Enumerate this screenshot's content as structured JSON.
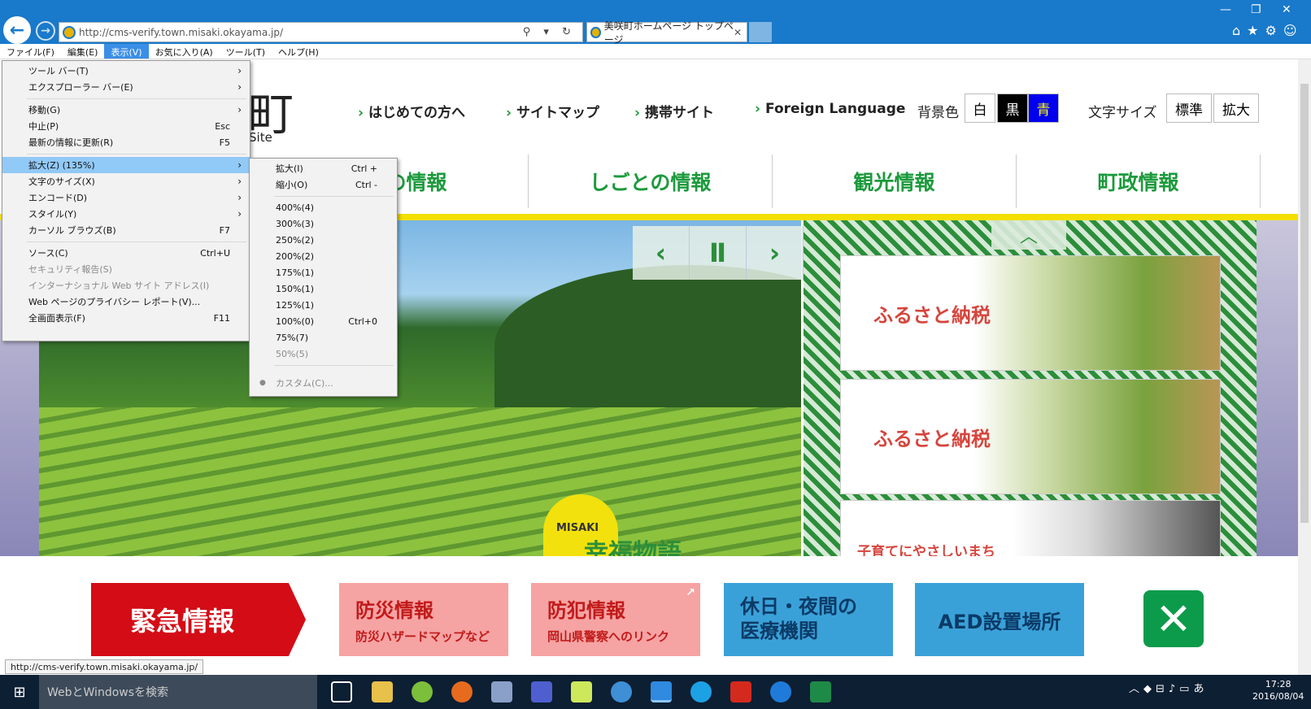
{
  "browser": {
    "url": "http://cms-verify.town.misaki.okayama.jp/",
    "url_tools": "⚲ ▾ ↻",
    "tab_title": "美咲町ホームページ トップページ",
    "status_url": "http://cms-verify.town.misaki.okayama.jp/"
  },
  "menubar": [
    "ファイル(F)",
    "編集(E)",
    "表示(V)",
    "お気に入り(A)",
    "ツール(T)",
    "ヘルプ(H)"
  ],
  "view_menu": {
    "toolbar": "ツール バー(T)",
    "explorer_bar": "エクスプローラー バー(E)",
    "goto": "移動(G)",
    "stop": "中止(P)",
    "stop_key": "Esc",
    "refresh": "最新の情報に更新(R)",
    "refresh_key": "F5",
    "zoom": "拡大(Z) (135%)",
    "text_size": "文字のサイズ(X)",
    "encoding": "エンコード(D)",
    "style": "スタイル(Y)",
    "caret": "カーソル ブラウズ(B)",
    "caret_key": "F7",
    "source": "ソース(C)",
    "source_key": "Ctrl+U",
    "security": "セキュリティ報告(S)",
    "intl": "インターナショナル Web サイト アドレス(I)",
    "privacy": "Web ページのプライバシー レポート(V)...",
    "fullscreen": "全画面表示(F)",
    "fullscreen_key": "F11"
  },
  "zoom_menu": {
    "zoom_in": "拡大(I)",
    "zoom_in_key": "Ctrl +",
    "zoom_out": "縮小(O)",
    "zoom_out_key": "Ctrl -",
    "z400": "400%(4)",
    "z300": "300%(3)",
    "z250": "250%(2)",
    "z200": "200%(2)",
    "z175": "175%(1)",
    "z150": "150%(1)",
    "z125": "125%(1)",
    "z100": "100%(0)",
    "z100_key": "Ctrl+0",
    "z75": "75%(7)",
    "z50": "50%(5)",
    "custom": "カスタム(C)..."
  },
  "site": {
    "logo_char": "町",
    "logo_site": "Site",
    "links": [
      "はじめての方へ",
      "サイトマップ",
      "携帯サイト",
      "Foreign Language"
    ],
    "bg_label": "背景色",
    "bg_white": "白",
    "bg_black": "黒",
    "bg_blue": "青",
    "font_label": "文字サイズ",
    "font_std": "標準",
    "font_big": "拡大",
    "nav": [
      "しの情報",
      "しごとの情報",
      "観光情報",
      "町政情報"
    ],
    "banner1": "ふるさと納税",
    "banner2": "ふるさと納税",
    "banner3": "子育てにやさしいまち",
    "misaki_tag": "MISAKI",
    "misaki_title": "幸福物語"
  },
  "emergency": {
    "title": "緊急情報",
    "bousai": "防災情報",
    "bousai_sub": "防災ハザードマップなど",
    "bouhan": "防犯情報",
    "bouhan_sub": "岡山県警察へのリンク",
    "kyujitsu": "休日・夜間の\n医療機関",
    "aed": "AED設置場所",
    "close": "✕"
  },
  "taskbar": {
    "search": "WebとWindowsを検索",
    "time": "17:28",
    "date": "2016/08/04"
  }
}
